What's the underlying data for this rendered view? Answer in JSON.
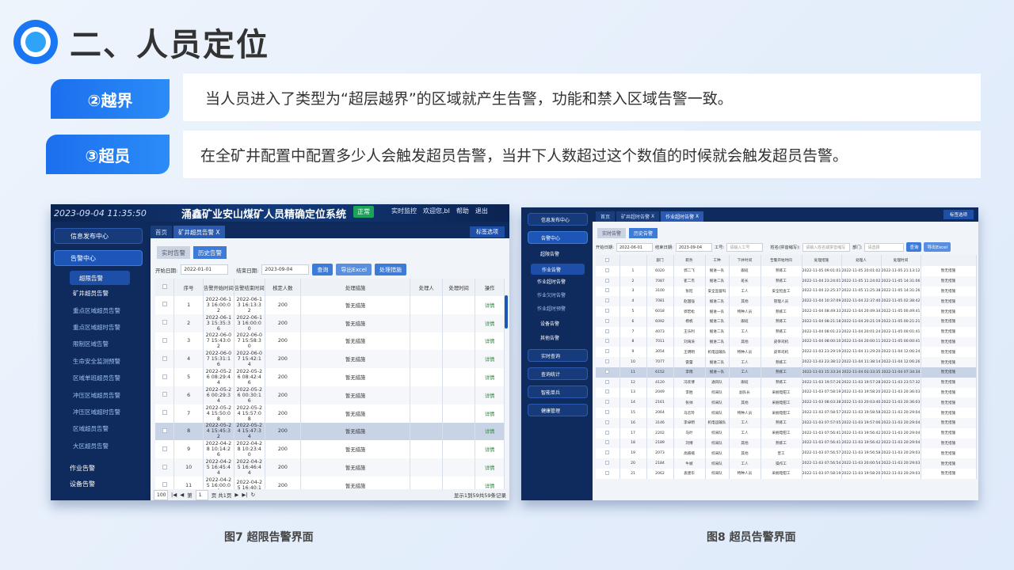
{
  "page": {
    "title": "二、人员定位"
  },
  "sections": [
    {
      "tag": "②越界",
      "desc": "当人员进入了类型为“超层越界”的区域就产生告警，功能和禁入区域告警一致。"
    },
    {
      "tag": "③超员",
      "desc": "在全矿井配置中配置多少人会触发超员告警，当井下人数超过这个数值的时候就会触发超员告警。"
    }
  ],
  "shot1": {
    "time": "2023-09-04 11:35:50",
    "system_title": "涌鑫矿业安山煤矿人员精确定位系统",
    "status_badge": "正常",
    "menu": [
      "实时监控",
      "欢迎您,bl",
      "帮助",
      "退出"
    ],
    "nav": {
      "info": "信息发布中心",
      "alarm": "告警中心",
      "over_limit": "超限告警",
      "work": "作业告警",
      "device": "设备告警"
    },
    "side_items": [
      "矿井超员告警",
      "重点区域超员告警",
      "重点区域超时告警",
      "限制区域告警",
      "生命安全监测预警",
      "区域单班超员告警",
      "冲压区域超员告警",
      "冲压区域超时告警",
      "区域超员告警",
      "大区超员告警"
    ],
    "tabs": [
      "首页",
      "矿井超员告警"
    ],
    "tab_close": "X",
    "tab_right": "标签选项",
    "subtabs": [
      "实时告警",
      "历史告警"
    ],
    "filter": {
      "start_label": "开始日期:",
      "start_value": "2022-01-01",
      "end_label": "结束日期:",
      "end_value": "2023-09-04",
      "query": "查询",
      "export": "导出Excel",
      "handle": "处理措施"
    },
    "columns": [
      "序号",
      "告警开始时间",
      "告警结束时间",
      "核定人数",
      "处理措施",
      "处理人",
      "处理时间",
      "操作"
    ],
    "rows": [
      {
        "n": "1",
        "s1": "2022-06-1",
        "s2": "3 16:00:0",
        "s3": "2",
        "e1": "2022-06-1",
        "e2": "3 16:13:3",
        "e3": "2",
        "cap": "200",
        "m": "暂无措施",
        "op": "详情"
      },
      {
        "n": "2",
        "s1": "2022-06-1",
        "s2": "3 15:35:3",
        "s3": "6",
        "e1": "2022-06-1",
        "e2": "3 16:00:0",
        "e3": "0",
        "cap": "200",
        "m": "暂无措施",
        "op": "详情"
      },
      {
        "n": "3",
        "s1": "2022-06-0",
        "s2": "7 15:43:0",
        "s3": "2",
        "e1": "2022-06-0",
        "e2": "7 15:58:3",
        "e3": "0",
        "cap": "200",
        "m": "暂无措施",
        "op": "详情"
      },
      {
        "n": "4",
        "s1": "2022-06-0",
        "s2": "7 15:31:1",
        "s3": "6",
        "e1": "2022-06-0",
        "e2": "7 15:42:1",
        "e3": "4",
        "cap": "200",
        "m": "暂无措施",
        "op": "详情"
      },
      {
        "n": "5",
        "s1": "2022-05-2",
        "s2": "6 08:29:4",
        "s3": "4",
        "e1": "2022-05-2",
        "e2": "6 08:42:4",
        "e3": "6",
        "cap": "200",
        "m": "暂无措施",
        "op": "详情"
      },
      {
        "n": "6",
        "s1": "2022-05-2",
        "s2": "6 00:29:3",
        "s3": "4",
        "e1": "2022-05-2",
        "e2": "6 00:30:1",
        "e3": "6",
        "cap": "200",
        "m": "暂无措施",
        "op": "详情"
      },
      {
        "n": "7",
        "s1": "2022-05-2",
        "s2": "4 15:50:0",
        "s3": "8",
        "e1": "2022-05-2",
        "e2": "4 15:57:0",
        "e3": "8",
        "cap": "200",
        "m": "暂无措施",
        "op": "详情"
      },
      {
        "n": "8",
        "s1": "2022-05-2",
        "s2": "4 15:45:3",
        "s3": "2",
        "e1": "2022-05-2",
        "e2": "4 15:47:3",
        "e3": "4",
        "cap": "200",
        "m": "暂无措施",
        "op": "详情"
      },
      {
        "n": "9",
        "s1": "2022-04-2",
        "s2": "8 10:14:2",
        "s3": "6",
        "e1": "2022-04-2",
        "e2": "8 10:23:4",
        "e3": "0",
        "cap": "200",
        "m": "暂无措施",
        "op": "详情"
      },
      {
        "n": "10",
        "s1": "2022-04-2",
        "s2": "5 16:45:4",
        "s3": "4",
        "e1": "2022-04-2",
        "e2": "5 16:46:4",
        "e3": "4",
        "cap": "200",
        "m": "暂无措施",
        "op": "详情"
      },
      {
        "n": "11",
        "s1": "2022-04-2",
        "s2": "5 16:00:0",
        "s3": "0",
        "e1": "2022-04-2",
        "e2": "5 16:40:1",
        "e3": "",
        "cap": "200",
        "m": "暂无措施",
        "op": "详情"
      }
    ],
    "pager": {
      "size": "100",
      "page_label": "第",
      "page": "1",
      "of": "页 共1页",
      "summary": "显示1到59共59条记录"
    }
  },
  "shot2": {
    "nav": [
      "信息发布中心",
      "告警中心",
      "超限告警",
      "作业告警",
      "设备告警",
      "其他告警",
      "实时查询",
      "查询统计",
      "智能单兵",
      "健康管理"
    ],
    "side_items": [
      "作业超时告警",
      "作业欠时告警",
      "作业超时预警"
    ],
    "tabs": [
      "首页",
      "矿井超时告警",
      "作业超时告警"
    ],
    "tab_close": "X",
    "tab_right": "标签选项",
    "subtabs": [
      "实时告警",
      "历史告警"
    ],
    "filter": {
      "start_label": "开始日期:",
      "start_value": "2022-06-01",
      "end_label": "结束日期:",
      "end_value": "2023-09-04",
      "id_label": "工号:",
      "id_ph": "请输入工号",
      "name_label": "姓名(拼音缩写):",
      "name_ph": "请输入姓名或拼音缩写",
      "dept_label": "部门:",
      "dept_ph": "请选择",
      "query": "查询",
      "export": "导出Excel"
    },
    "columns": [
      "",
      "部门",
      "职务",
      "工种",
      "下井时间",
      "告警开始时间",
      "处理措施",
      "处理人",
      "处理时间"
    ],
    "rows": [
      [
        "1",
        "6020",
        "郭二飞",
        "掘进一队",
        "跟班",
        "熟练工",
        "2022-11-05 09:01:01",
        "2022-11-05 20:01:02",
        "2022-11-05 21:13:12",
        "暂无措施"
      ],
      [
        "2",
        "7087",
        "崔二杰",
        "掘进二队",
        "班长",
        "熟练工",
        "2022-11-04 23:24:01",
        "2022-11-05 11:24:02",
        "2022-11-05 14:31:06",
        "暂无措施"
      ],
      [
        "3",
        "3100",
        "张旺",
        "安全监督科",
        "工人",
        "安全检查工",
        "2022-11-04 22:25:37",
        "2022-11-05 11:25:38",
        "2022-11-05 14:31:26",
        "暂无措施"
      ],
      [
        "4",
        "7081",
        "赵国强",
        "掘进二队",
        "其他",
        "管理人员",
        "2022-11-04 10:37:09",
        "2022-11-04 22:37:40",
        "2022-11-05 02:38:42",
        "暂无措施"
      ],
      [
        "5",
        "6018",
        "郭宏松",
        "掘进一队",
        "特种人员",
        "熟练工",
        "2022-11-04 08:49:33",
        "2022-11-04 20:49:34",
        "2022-11-05 00:49:41",
        "暂无措施"
      ],
      [
        "6",
        "6092",
        "杨帆",
        "掘进二队",
        "跟班",
        "熟练工",
        "2022-11-04 08:21:18",
        "2022-11-04 20:21:19",
        "2022-11-05 00:21:21",
        "暂无措施"
      ],
      [
        "7",
        "4073",
        "王乐利",
        "掘进二队",
        "工人",
        "熟练工",
        "2022-11-04 08:01:23",
        "2022-11-04 20:01:24",
        "2022-11-05 00:01:41",
        "暂无措施"
      ],
      [
        "8",
        "7011",
        "刘海涛",
        "掘进二队",
        "其他",
        "皮带司机",
        "2022-11-04 08:00:10",
        "2022-11-04 20:00:11",
        "2022-11-05 00:00:41",
        "暂无措施"
      ],
      [
        "9",
        "3054",
        "王明明",
        "机电运输队",
        "特种人员",
        "皮带司机",
        "2022-11-03 23:29:19",
        "2022-11-04 11:29:20",
        "2022-11-04 12:06:24",
        "暂无措施"
      ],
      [
        "10",
        "7077",
        "雷蕾",
        "掘进二队",
        "工人",
        "熟练工",
        "2022-11-03 23:38:12",
        "2022-11-04 11:38:14",
        "2022-11-04 12:06:26",
        "暂无措施"
      ],
      [
        "11",
        "6152",
        "李雨",
        "掘进一队",
        "工人",
        "熟练工",
        "2022-11-03 15:33:34",
        "2022-11-04 03:33:35",
        "2022-11-04 07:34:34",
        "暂无措施"
      ],
      [
        "12",
        "4120",
        "冯欢博",
        "通风队",
        "跟班",
        "熟练工",
        "2022-11-03 19:57:26",
        "2022-11-03 19:57:28",
        "2022-11-03 23:57:32",
        "暂无措施"
      ],
      [
        "13",
        "2049",
        "李胜",
        "综采队",
        "副队长",
        "采掘电钳工",
        "2022-11-03 07:58:19",
        "2022-11-03 19:58:20",
        "2022-11-03 20:36:03",
        "暂无措施"
      ],
      [
        "14",
        "2161",
        "张帅",
        "综采队",
        "其他",
        "采掘电钳工",
        "2022-11-03 08:03:38",
        "2022-11-03 20:03:40",
        "2022-11-03 20:36:03",
        "暂无措施"
      ],
      [
        "15",
        "2064",
        "马云玲",
        "综采队",
        "特种人员",
        "采掘电钳工",
        "2022-11-03 07:58:57",
        "2022-11-03 19:58:58",
        "2022-11-03 20:29:04",
        "暂无措施"
      ],
      [
        "16",
        "3146",
        "李卓明",
        "机电运输队",
        "工人",
        "熟练工",
        "2022-11-03 07:57:05",
        "2022-11-03 19:57:06",
        "2022-11-03 20:29:04",
        "暂无措施"
      ],
      [
        "17",
        "2202",
        "马叶",
        "综采队",
        "工人",
        "采掘电钳工",
        "2022-11-03 07:56:41",
        "2022-11-03 19:56:42",
        "2022-11-03 20:29:04",
        "暂无措施"
      ],
      [
        "18",
        "2189",
        "刘博",
        "综采队",
        "其他",
        "熟练工",
        "2022-11-03 07:56:41",
        "2022-11-03 19:56:42",
        "2022-11-03 20:29:04",
        "暂无措施"
      ],
      [
        "19",
        "2073",
        "高楠楠",
        "综采队",
        "其他",
        "普工",
        "2022-11-03 07:56:57",
        "2022-11-03 19:56:58",
        "2022-11-03 20:29:03",
        "暂无措施"
      ],
      [
        "20",
        "2184",
        "牛斌",
        "综采队",
        "工人",
        "操作工",
        "2022-11-03 07:56:54",
        "2022-11-03 20:00:54",
        "2022-11-03 20:29:03",
        "暂无措施"
      ],
      [
        "21",
        "2062",
        "袁建华",
        "综采队",
        "特种人员",
        "采掘电钳工",
        "2022-11-03 07:58:19",
        "2022-11-03 19:58:20",
        "2022-11-03 20:29:03",
        "暂无措施"
      ]
    ]
  },
  "captions": [
    "图7 超限告警界面",
    "图8 超员告警界面"
  ]
}
